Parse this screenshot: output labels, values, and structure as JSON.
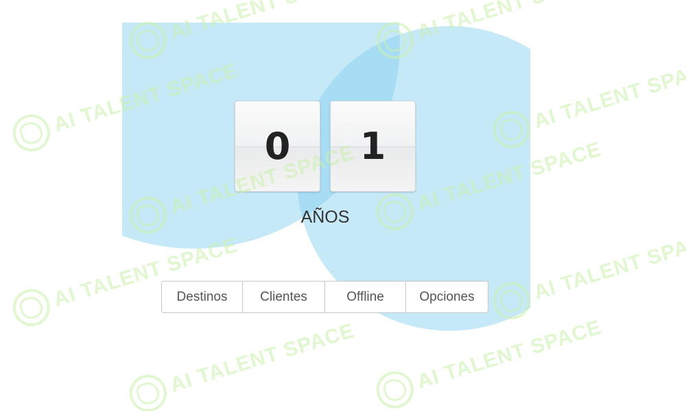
{
  "counter": {
    "digits": [
      "0",
      "1"
    ],
    "unit_label": "AÑOS"
  },
  "nav_buttons": [
    {
      "label": "Destinos"
    },
    {
      "label": "Clientes"
    },
    {
      "label": "Offline"
    },
    {
      "label": "Opciones"
    }
  ],
  "watermark": {
    "text": "AI TALENT SPACE"
  },
  "colors": {
    "circle_fill": "#80cef0",
    "watermark": "#c8f0aa",
    "digit_text": "#222222",
    "button_text": "#555555"
  }
}
